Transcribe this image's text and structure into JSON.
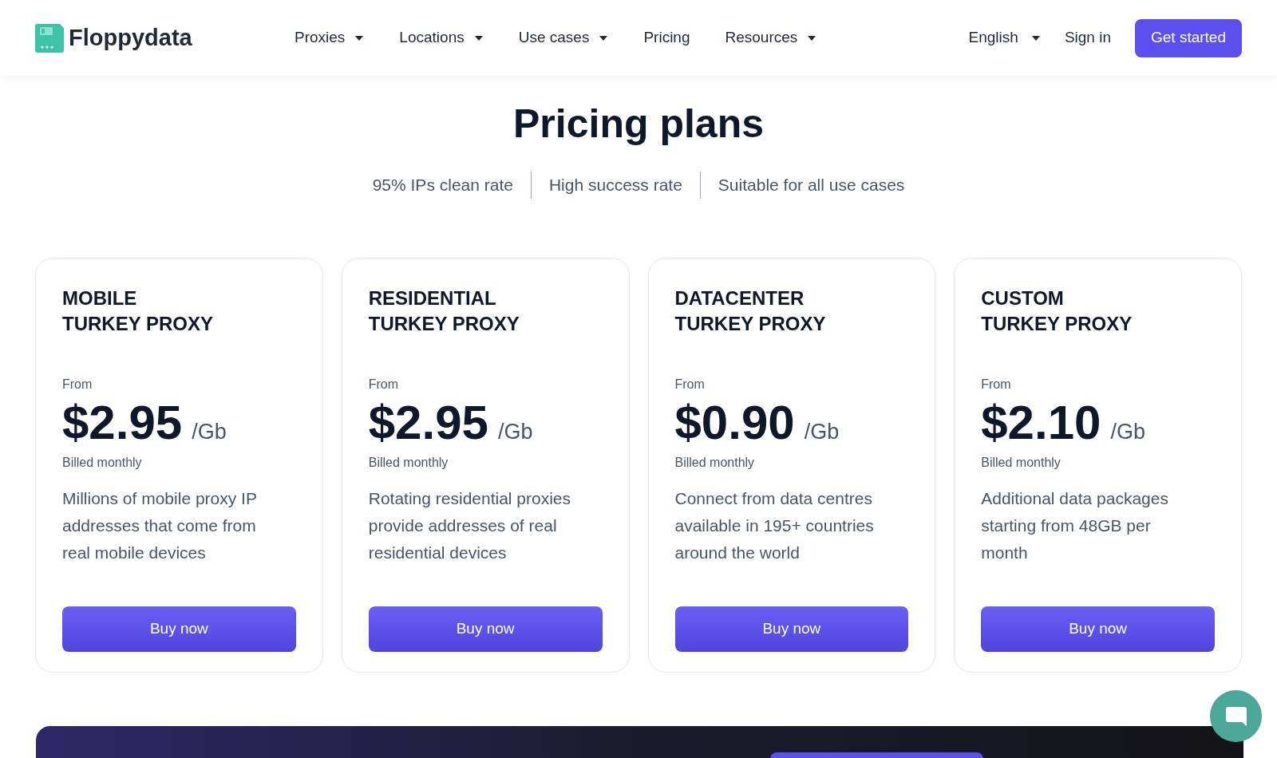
{
  "header": {
    "logo": "Floppydata",
    "nav": [
      {
        "label": "Proxies",
        "dropdown": true
      },
      {
        "label": "Locations",
        "dropdown": true
      },
      {
        "label": "Use cases",
        "dropdown": true
      },
      {
        "label": "Pricing",
        "dropdown": false
      },
      {
        "label": "Resources",
        "dropdown": true
      }
    ],
    "language": "English",
    "sign_in": "Sign in",
    "cta": "Get started"
  },
  "heading": "Pricing plans",
  "features": [
    "95% IPs clean rate",
    "High success rate",
    "Suitable for all use cases"
  ],
  "plans": [
    {
      "title": [
        "MOBILE",
        "TURKEY PROXY"
      ],
      "from": "From",
      "price": "$2.95",
      "unit": "/Gb",
      "billing": "Billed monthly",
      "description": "Millions of mobile proxy IP addresses that come from real mobile devices",
      "button": "Buy now"
    },
    {
      "title": [
        "RESIDENTIAL",
        "TURKEY PROXY"
      ],
      "from": "From",
      "price": "$2.95",
      "unit": "/Gb",
      "billing": "Billed monthly",
      "description": "Rotating residential proxies provide addresses of real residential devices",
      "button": "Buy now"
    },
    {
      "title": [
        "DATACENTER",
        "TURKEY PROXY"
      ],
      "from": "From",
      "price": "$0.90",
      "unit": "/Gb",
      "billing": "Billed monthly",
      "description": "Connect from data centres available in 195+ countries around the world",
      "button": "Buy now"
    },
    {
      "title": [
        "CUSTOM",
        "TURKEY PROXY"
      ],
      "from": "From",
      "price": "$2.10",
      "unit": "/Gb",
      "billing": "Billed monthly",
      "description": "Additional data packages starting from 48GB per month",
      "button": "Buy now"
    }
  ]
}
